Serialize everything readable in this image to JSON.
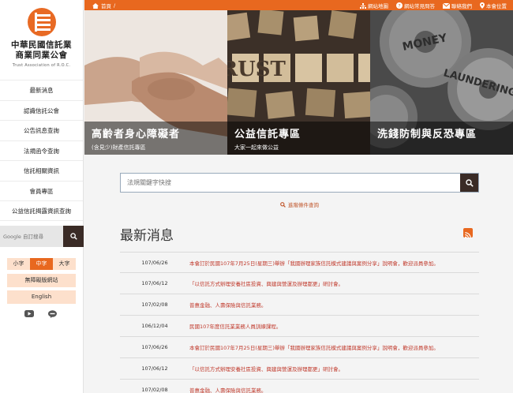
{
  "org": {
    "name_line1": "中華民國信託業",
    "name_line2": "商業同業公會",
    "name_en": "Trust Association of R.O.C."
  },
  "sidebar": {
    "items": [
      {
        "label": "最新消息"
      },
      {
        "label": "認識信託公會"
      },
      {
        "label": "公告訊息查詢"
      },
      {
        "label": "法規函令查詢"
      },
      {
        "label": "信託相關資訊"
      },
      {
        "label": "會員專區"
      },
      {
        "label": "公益信託揭露資訊查詢"
      }
    ],
    "search_placeholder": "Google 自訂搜尋",
    "font_sizes": [
      "小字",
      "中字",
      "大字"
    ],
    "accessible_site": "無障礙版網站",
    "english": "English"
  },
  "topbar": {
    "home": "首頁",
    "separator": "/",
    "links": [
      {
        "icon": "sitemap-icon",
        "label": "網站地圖"
      },
      {
        "icon": "question-icon",
        "label": "網站常見問答"
      },
      {
        "icon": "mail-icon",
        "label": "聯絡我們"
      },
      {
        "icon": "location-icon",
        "label": "本會位置"
      }
    ]
  },
  "banners": [
    {
      "title": "高齡者身心障礙者",
      "subtitle": "(含見少)財產信託專區"
    },
    {
      "title": "公益信託專區",
      "subtitle": "大家一起來做公益",
      "image_words": [
        "TRUST"
      ]
    },
    {
      "title": "洗錢防制與反恐專區",
      "subtitle": "",
      "image_words": [
        "MONEY",
        "LAUNDERING"
      ]
    }
  ],
  "search": {
    "placeholder": "法規關鍵字快搜",
    "advanced": "進階條件查詢"
  },
  "news": {
    "title": "最新消息",
    "items": [
      {
        "date": "107/06/26",
        "text": "本會訂於民國107年7月25日(星期三)舉辦「我國辦理家族信託模式建議與案例分享」說明會，歡迎派員參加。"
      },
      {
        "date": "107/06/12",
        "text": "「以信託方式辦理安養社區投資、興建與營運及辦理都更」研討會。"
      },
      {
        "date": "107/02/08",
        "text": "普惠金融、人壽保險與信託業務。"
      },
      {
        "date": "106/12/04",
        "text": "民國107年度信託業業務人員訓練課程。"
      },
      {
        "date": "107/06/26",
        "text": "本會訂於民國107年7月25日(星期三)舉辦「我國辦理家族信託模式建議與案例分享」說明會，歡迎派員參加。"
      },
      {
        "date": "107/06/12",
        "text": "「以信託方式辦理安養社區投資、興建與營運及辦理都更」研討會。"
      },
      {
        "date": "107/02/08",
        "text": "普惠金融、人壽保險與信託業務。"
      }
    ]
  },
  "colors": {
    "accent": "#e8681f",
    "dark": "#3a2b26",
    "news_link": "#c0392b"
  }
}
